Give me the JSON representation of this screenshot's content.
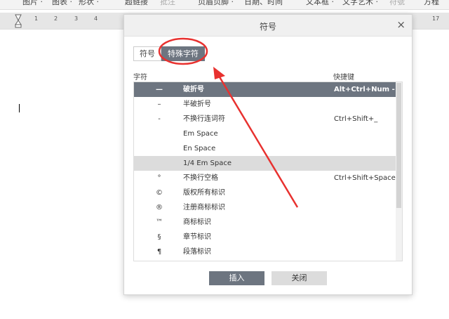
{
  "toolbar": {
    "items": [
      "图片 ·",
      "图表 ·",
      "形状 ·",
      "超链接",
      "批注",
      "页眉页脚 ·",
      "日期、时间",
      "文本框 ·",
      "文字艺术 ·",
      "符號",
      "方程"
    ]
  },
  "ruler": {
    "left": [
      "1",
      "2",
      "3",
      "4"
    ],
    "right": "17"
  },
  "dialog": {
    "title": "符号",
    "close_icon": "×",
    "tabs": [
      {
        "label": "符号",
        "active": false
      },
      {
        "label": "特殊字符",
        "active": true
      }
    ],
    "headers": {
      "char": "字符",
      "shortcut": "快捷键"
    },
    "rows": [
      {
        "char": "—",
        "name": "破折号",
        "shortcut": "Alt+Ctrl+Num -",
        "state": "selected"
      },
      {
        "char": "–",
        "name": "半破折号",
        "shortcut": ""
      },
      {
        "char": "-",
        "name": "不换行连词符",
        "shortcut": "Ctrl+Shift+_"
      },
      {
        "char": "",
        "name": "Em Space",
        "shortcut": ""
      },
      {
        "char": "",
        "name": "En Space",
        "shortcut": ""
      },
      {
        "char": "",
        "name": "1/4 Em Space",
        "shortcut": "",
        "state": "hover"
      },
      {
        "char": "°",
        "name": "不换行空格",
        "shortcut": "Ctrl+Shift+Space"
      },
      {
        "char": "©",
        "name": "版权所有标识",
        "shortcut": ""
      },
      {
        "char": "®",
        "name": "注册商标标识",
        "shortcut": ""
      },
      {
        "char": "™",
        "name": "商标标识",
        "shortcut": ""
      },
      {
        "char": "§",
        "name": "章节标识",
        "shortcut": ""
      },
      {
        "char": "¶",
        "name": "段落标识",
        "shortcut": ""
      }
    ],
    "buttons": {
      "insert": "插入",
      "close": "关闭"
    }
  },
  "annotation_color": "#e8312f"
}
